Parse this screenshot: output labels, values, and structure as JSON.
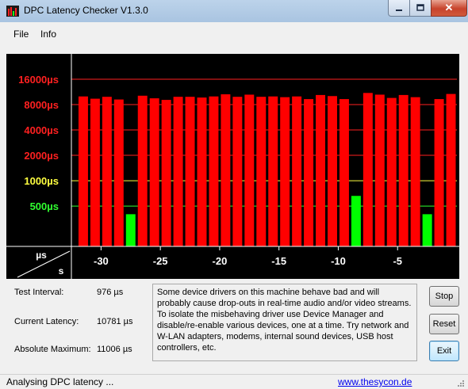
{
  "window": {
    "title": "DPC Latency Checker V1.3.0",
    "close_glyph": "✕"
  },
  "menu": [
    {
      "label": "File"
    },
    {
      "label": "Info"
    }
  ],
  "chart_data": {
    "type": "bar",
    "y_scale": "log",
    "y_tick_labels": [
      "16000µs",
      "8000µs",
      "4000µs",
      "2000µs",
      "1000µs",
      "500µs"
    ],
    "y_tick_values": [
      16000,
      8000,
      4000,
      2000,
      1000,
      500
    ],
    "y_tick_colors": [
      "#ff2020",
      "#ff2020",
      "#ff2020",
      "#ff2020",
      "#ffff40",
      "#30ff30"
    ],
    "ylim": [
      166,
      32000
    ],
    "x_unit": "s",
    "y_unit": "µs",
    "x_tick_labels": [
      "-30",
      "-25",
      "-20",
      "-15",
      "-10",
      "-5"
    ],
    "x_tick_values": [
      -30,
      -25,
      -20,
      -15,
      -10,
      -5
    ],
    "xlim": [
      -32.5,
      0
    ],
    "bar_times": [
      -32,
      -31,
      -30,
      -29,
      -28,
      -27,
      -26,
      -25,
      -24,
      -23,
      -22,
      -21,
      -20,
      -19,
      -18,
      -17,
      -16,
      -15,
      -14,
      -13,
      -12,
      -11,
      -10,
      -9,
      -8,
      -7,
      -6,
      -5,
      -4,
      -3,
      -2,
      -1
    ],
    "values": [
      10000,
      9400,
      9900,
      9200,
      400,
      10200,
      9500,
      9100,
      9900,
      9900,
      9700,
      10000,
      10600,
      9900,
      10500,
      9900,
      10000,
      9800,
      10000,
      9300,
      10400,
      10100,
      9300,
      660,
      11000,
      10500,
      9600,
      10400,
      9800,
      400,
      9300,
      10700,
      11000
    ],
    "bar_colors": {
      "high": "#ff0000",
      "ok": "#00ff00"
    },
    "ok_threshold": 1000,
    "colors": {
      "background": "#000000",
      "grid": "#cc0000",
      "axis": "#ffffff"
    }
  },
  "stats": [
    {
      "label": "Test Interval:",
      "value": "976 µs"
    },
    {
      "label": "Current Latency:",
      "value": "10781 µs"
    },
    {
      "label": "Absolute Maximum:",
      "value": "11006 µs"
    }
  ],
  "message": "Some device drivers on this machine behave bad and will probably cause drop-outs in real-time audio and/or video streams. To isolate the misbehaving driver use Device Manager and disable/re-enable various devices, one at a time. Try network and W-LAN adapters, modems, internal sound devices, USB host controllers, etc.",
  "buttons": {
    "stop": "Stop",
    "reset": "Reset",
    "exit": "Exit"
  },
  "status": {
    "text": "Analysing DPC latency ...",
    "link": "www.thesycon.de"
  }
}
